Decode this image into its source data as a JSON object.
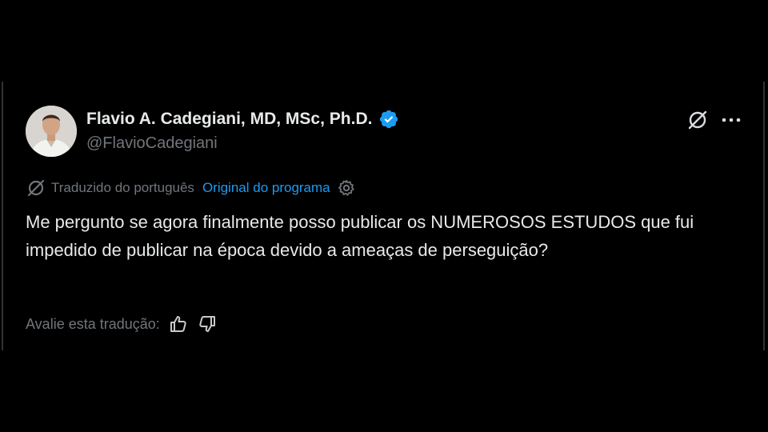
{
  "tweet": {
    "author": {
      "name": "Flavio A. Cadegiani, MD, MSc, Ph.D.",
      "handle": "@FlavioCadegiani",
      "verified": true
    },
    "translation": {
      "label": "Traduzido do português",
      "original_link": "Original do programa"
    },
    "text": "Me pergunto se agora finalmente posso publicar os NUMEROSOS ESTUDOS que fui impedido de publicar na época devido a ameaças de perseguição?",
    "rate": {
      "label": "Avalie esta tradução:"
    }
  },
  "icons": {
    "verified": "verified-badge-icon",
    "grok": "grok-icon",
    "more": "more-icon",
    "translate": "translate-icon",
    "settings": "gear-icon",
    "thumbs_up": "thumbs-up-icon",
    "thumbs_down": "thumbs-down-icon"
  },
  "colors": {
    "background": "#000000",
    "text_primary": "#e7e9ea",
    "text_secondary": "#71767b",
    "link": "#1d9bf0",
    "verified": "#1d9bf0",
    "border": "#2f3336"
  }
}
